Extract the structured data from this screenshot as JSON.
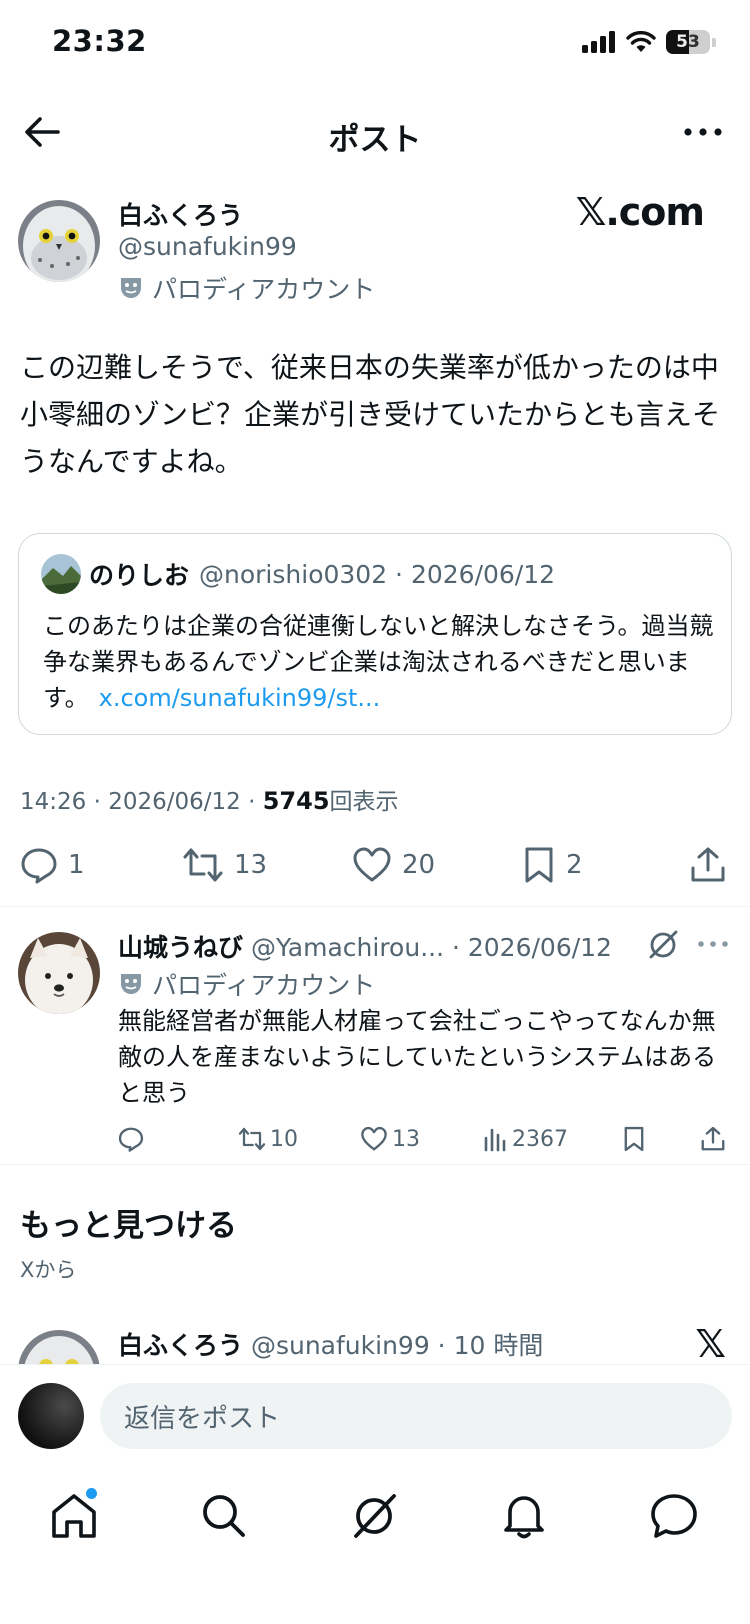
{
  "status_bar": {
    "time": "23:32",
    "battery": "53",
    "battery_level": 0.53
  },
  "header": {
    "title": "ポスト"
  },
  "post": {
    "author_name": "白ふくろう",
    "handle": "@sunafukin99",
    "parody_label": "パロディアカウント",
    "watermark": "𝕏.com",
    "text": "この辺難しそうで、従来日本の失業率が低かったのは中小零細のゾンビ？企業が引き受けていたからとも言えそうなんですよね。",
    "quote": {
      "name": "のりしお",
      "meta": "@norishio0302 · 2026/06/12",
      "text": "このあたりは企業の合従連衡しないと解決しなさそう。過当競争な業界もあるんでゾンビ企業は淘汰されるべきだと思います。",
      "link": "x.com/sunafukin99/st..."
    },
    "meta_time": "14:26 · 2026/06/12 · ",
    "views_count": "5745",
    "views_label": "回表示",
    "counts": {
      "replies": "1",
      "reposts": "13",
      "likes": "20",
      "bookmarks": "2"
    }
  },
  "reply": {
    "name": "山城うねび",
    "meta": "@Yamachirou... · 2026/06/12",
    "parody_label": "パロディアカウント",
    "text": "無能経営者が無能人材雇って会社ごっこやってなんか無敵の人を産まないようにしていたというシステムはあると思う",
    "counts": {
      "reposts": "10",
      "likes": "13",
      "views": "2367"
    }
  },
  "discover": {
    "title": "もっと見つける",
    "subtitle": "Xから",
    "next": {
      "name": "白ふくろう",
      "meta": "@sunafukin99 · 10 時間",
      "logo": "𝕏"
    }
  },
  "composer": {
    "placeholder": "返信をポスト"
  },
  "tabs": [
    "home-icon",
    "search-icon",
    "grok-icon",
    "notifications-icon",
    "messages-icon"
  ],
  "colors": {
    "accent": "#1d9bf0",
    "text": "#0f1419",
    "secondary": "#536471",
    "divider": "#eff3f4"
  }
}
